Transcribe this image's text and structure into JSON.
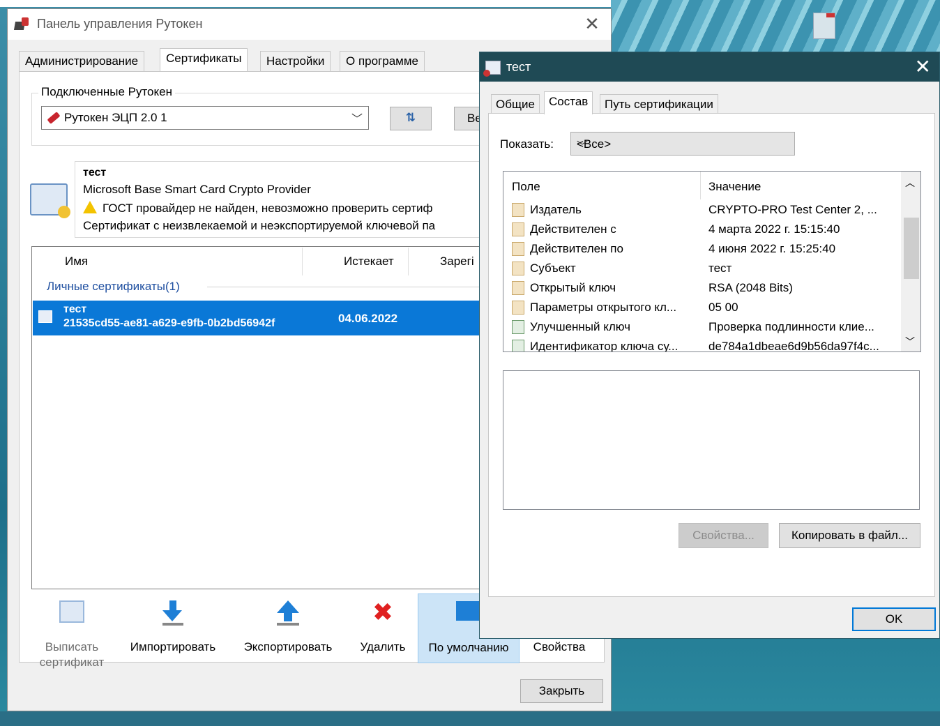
{
  "main": {
    "title": "Панель управления Рутокен",
    "close": "✕",
    "tabs": [
      "Администрирование",
      "Сертификаты",
      "Настройки",
      "О программе"
    ],
    "group_label": "Подключенные Рутокен",
    "token_selected": "Рутокен ЭЦП 2.0 1",
    "refresh_glyph": "⇅",
    "ve_button": "Ве",
    "cert_info": {
      "name": "тест",
      "provider": "Microsoft Base Smart Card Crypto Provider",
      "warning": "ГОСТ провайдер не найден, невозможно проверить сертиф",
      "note": "Сертификат с неизвлекаемой и неэкспортируемой ключевой па"
    },
    "list": {
      "columns": [
        "Имя",
        "Истекает",
        "Зарегі"
      ],
      "group": "Личные сертификаты(1)",
      "row": {
        "name": "тест",
        "id": "21535cd55-ae81-a629-e9fb-0b2bd56942f",
        "expires": "04.06.2022"
      }
    },
    "toolbar": {
      "issue": "Выписать сертификат",
      "import": "Импортировать",
      "export": "Экспортировать",
      "delete": "Удалить",
      "default": "По умолчанию",
      "properties": "Свойства"
    },
    "close_button": "Закрыть"
  },
  "dialog": {
    "title": "тест",
    "close": "✕",
    "tabs": [
      "Общие",
      "Состав",
      "Путь сертификации"
    ],
    "show_label": "Показать:",
    "show_value": "<Все>",
    "columns": {
      "field": "Поле",
      "value": "Значение"
    },
    "rows": [
      {
        "field": "Издатель",
        "value": "CRYPTO-PRO Test Center 2, ...",
        "icon": "doc-icon"
      },
      {
        "field": "Действителен с",
        "value": "4 марта 2022 г. 15:15:40",
        "icon": "doc-icon"
      },
      {
        "field": "Действителен по",
        "value": "4 июня 2022 г. 15:25:40",
        "icon": "doc-icon"
      },
      {
        "field": "Субъект",
        "value": "тест",
        "icon": "doc-icon"
      },
      {
        "field": "Открытый ключ",
        "value": "RSA (2048 Bits)",
        "icon": "doc-icon"
      },
      {
        "field": "Параметры открытого кл...",
        "value": "05 00",
        "icon": "doc-icon"
      },
      {
        "field": "Улучшенный ключ",
        "value": "Проверка подлинности клие...",
        "icon": "extension-icon"
      },
      {
        "field": "Идентификатор ключа су...",
        "value": "de784a1dbeae6d9b56da97f4c...",
        "icon": "extension-icon"
      }
    ],
    "buttons": {
      "properties": "Свойства...",
      "copy": "Копировать в файл...",
      "ok": "OK"
    }
  }
}
